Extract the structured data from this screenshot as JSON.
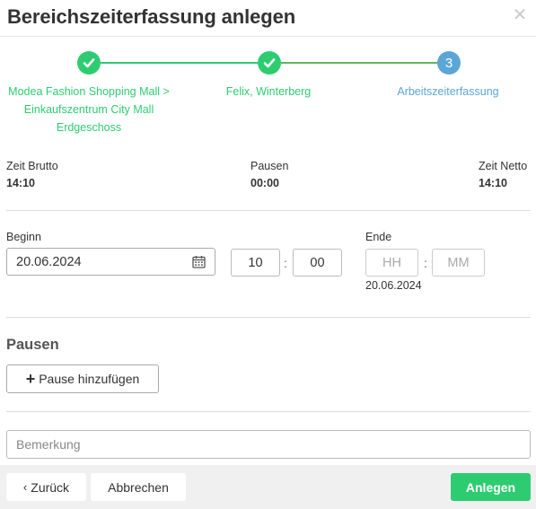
{
  "dialog": {
    "title": "Bereichszeiterfassung anlegen",
    "close_symbol": "✕"
  },
  "stepper": {
    "steps": [
      {
        "label_lines": [
          "Modea Fashion Shopping Mall >",
          "Einkaufszentrum City Mall",
          "Erdgeschoss"
        ],
        "status": "done",
        "icon": "check-icon"
      },
      {
        "label_lines": [
          "Felix, Winterberg"
        ],
        "status": "done",
        "icon": "check-icon"
      },
      {
        "label_lines": [
          "Arbeitszeiterfassung"
        ],
        "status": "active",
        "number": "3"
      }
    ],
    "colors": {
      "done": "#2ecc71",
      "active": "#5ba6d6"
    }
  },
  "summary": {
    "brutto": {
      "label": "Zeit Brutto",
      "value": "14:10"
    },
    "pausen": {
      "label": "Pausen",
      "value": "00:00"
    },
    "netto": {
      "label": "Zeit Netto",
      "value": "14:10"
    }
  },
  "beginn": {
    "label": "Beginn",
    "date": "20.06.2024",
    "hour": "10",
    "minute": "00"
  },
  "ende": {
    "label": "Ende",
    "hour_placeholder": "HH",
    "minute_placeholder": "MM",
    "date": "20.06.2024"
  },
  "pausen_section": {
    "title": "Pausen",
    "add_label": "Pause hinzufügen"
  },
  "bemerkung": {
    "placeholder": "Bemerkung"
  },
  "footer": {
    "back_label": "Zurück",
    "cancel_label": "Abbrechen",
    "create_label": "Anlegen",
    "accent_color": "#2ecc71"
  }
}
